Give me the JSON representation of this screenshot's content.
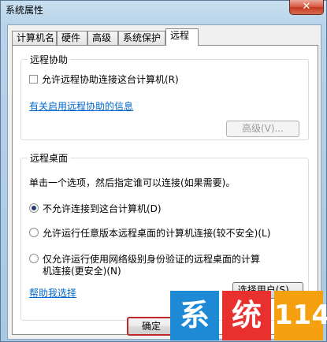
{
  "window": {
    "title": "系统属性",
    "close_glyph": "✕"
  },
  "tabs": [
    {
      "label": "计算机名"
    },
    {
      "label": "硬件"
    },
    {
      "label": "高级"
    },
    {
      "label": "系统保护"
    },
    {
      "label": "远程"
    }
  ],
  "remote_assistance": {
    "title": "远程协助",
    "allow_label": "允许远程协助连接这台计算机(R)",
    "allow_checked": false,
    "info_link": "有关启用远程协助的信息",
    "advanced_button": "高级(V)..."
  },
  "remote_desktop": {
    "title": "远程桌面",
    "instruction": "单击一个选项，然后指定谁可以连接(如果需要)。",
    "options": [
      {
        "label": "不允许连接到这台计算机(D)",
        "selected": true
      },
      {
        "label": "允许运行任意版本远程桌面的计算机连接(较不安全)(L)",
        "selected": false
      },
      {
        "label": "仅允许运行使用网络级别身份验证的远程桌面的计算",
        "label_line2": "机连接(更安全)(N)",
        "selected": false
      }
    ],
    "help_link": "帮助我选择",
    "select_users_button": "选择用户(S)..."
  },
  "footer": {
    "ok_button": "确定"
  },
  "watermark": {
    "chars": [
      "系",
      "统",
      "114"
    ],
    "colors": [
      "#1e8ad6",
      "#e8312f",
      "#f5a00f"
    ]
  }
}
